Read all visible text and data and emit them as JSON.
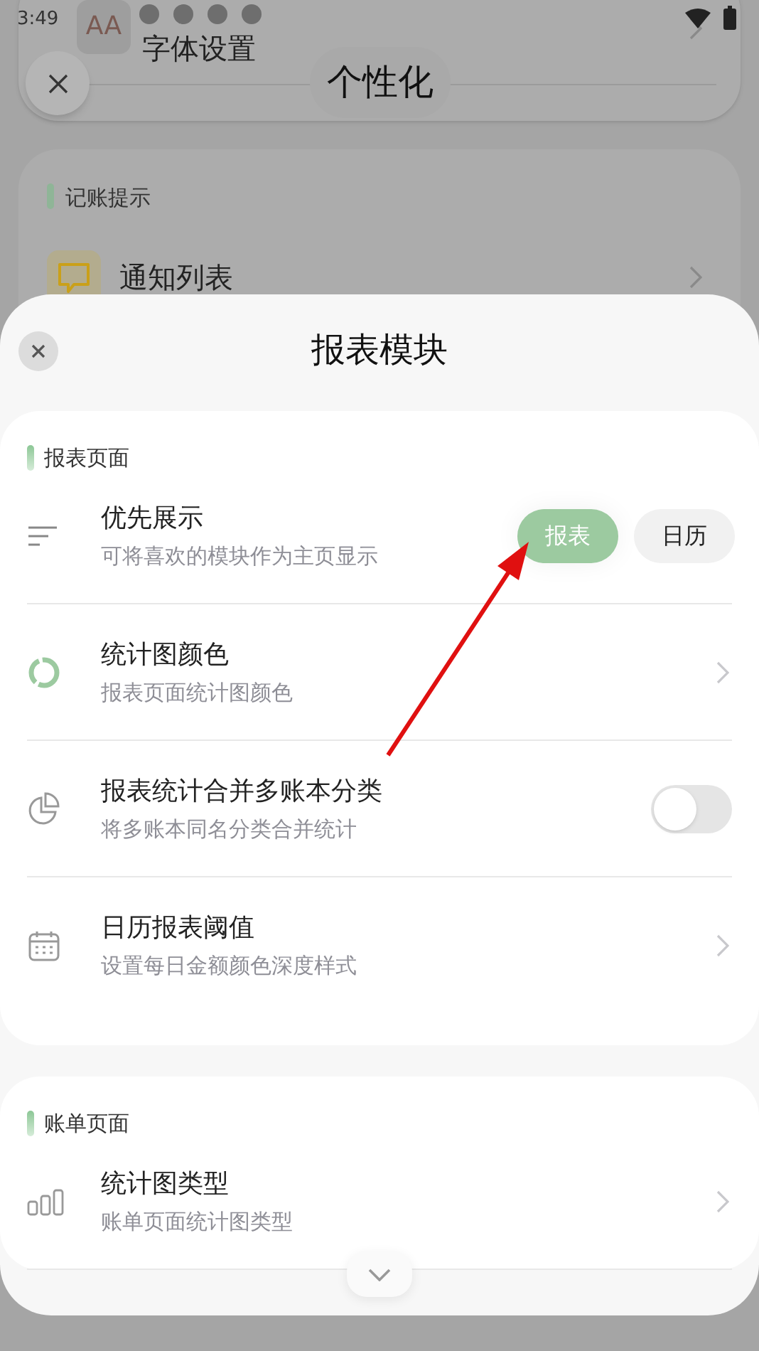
{
  "status_bar": {
    "time": "3:49"
  },
  "background": {
    "title": "个性化",
    "top_row": {
      "icon_text": "AA",
      "label": "字体设置"
    },
    "section": {
      "title": "记账提示",
      "rows": [
        {
          "label": "通知列表"
        }
      ]
    }
  },
  "sheet": {
    "title": "报表模块",
    "sections": [
      {
        "title": "报表页面",
        "rows": [
          {
            "kind": "segmented",
            "title": "优先展示",
            "subtitle": "可将喜欢的模块作为主页显示",
            "options": [
              {
                "label": "报表",
                "selected": true
              },
              {
                "label": "日历",
                "selected": false
              }
            ]
          },
          {
            "kind": "link",
            "title": "统计图颜色",
            "subtitle": "报表页面统计图颜色"
          },
          {
            "kind": "toggle",
            "title": "报表统计合并多账本分类",
            "subtitle": "将多账本同名分类合并统计",
            "on": false
          },
          {
            "kind": "link",
            "title": "日历报表阈值",
            "subtitle": "设置每日金额颜色深度样式"
          }
        ]
      },
      {
        "title": "账单页面",
        "rows": [
          {
            "kind": "link",
            "title": "统计图类型",
            "subtitle": "账单页面统计图类型"
          }
        ]
      }
    ]
  }
}
